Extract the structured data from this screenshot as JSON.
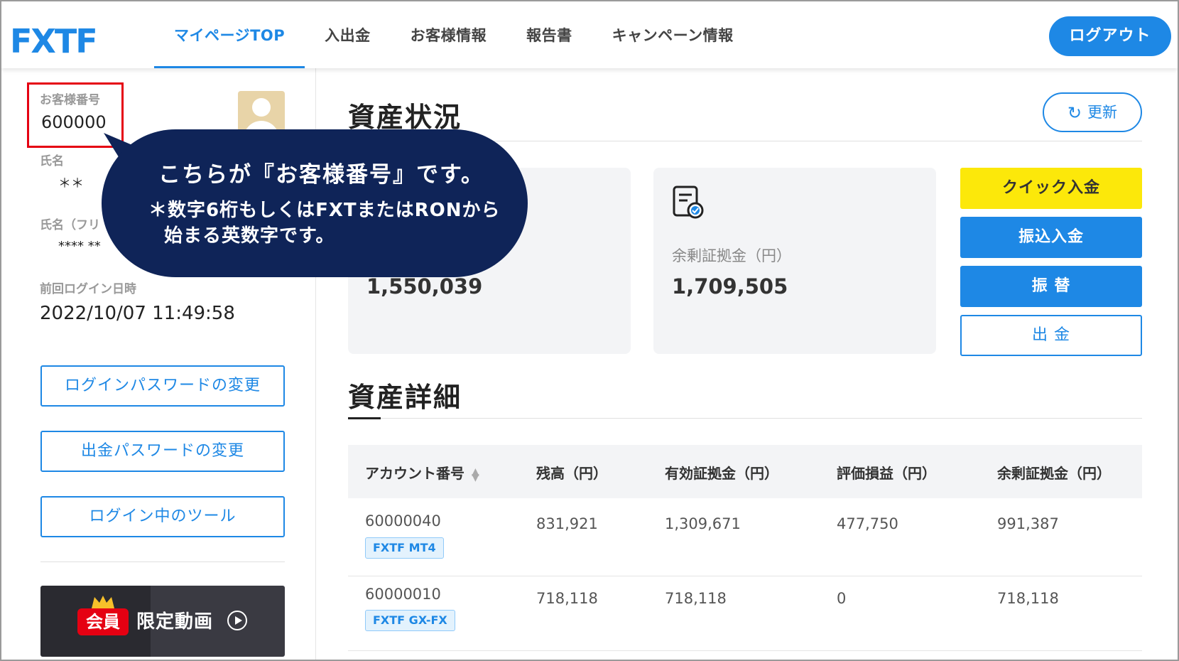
{
  "header": {
    "logo_text": "FXTF",
    "nav": [
      "マイページTOP",
      "入出金",
      "お客様情報",
      "報告書",
      "キャンペーン情報"
    ],
    "logout_label": "ログアウト"
  },
  "sidebar": {
    "customer_number_label": "お客様番号",
    "customer_number": "600000",
    "name_label": "氏名",
    "name_value": "＊＊",
    "kana_label": "氏名（フリ",
    "kana_value": "**** **",
    "last_login_label": "前回ログイン日時",
    "last_login_value": "2022/10/07 11:49:58",
    "buttons": [
      "ログインパスワードの変更",
      "出金パスワードの変更",
      "ログイン中のツール"
    ],
    "member_badge": "会員",
    "member_text": "限定動画"
  },
  "callout": {
    "title": "こちらが『お客様番号』です。",
    "note_line1": "＊数字6桁もしくはFXTまたはRONから",
    "note_line2": "始まる英数字です。"
  },
  "assets": {
    "title": "資産状況",
    "refresh_label": "更新",
    "cards": [
      {
        "label": "",
        "value": "1,550,039",
        "icon": "clipboard-icon"
      },
      {
        "label": "余剰証拠金（円）",
        "value": "1,709,505",
        "icon": "document-check-icon"
      }
    ],
    "actions": [
      "クイック入金",
      "振込入金",
      "振 替",
      "出 金"
    ]
  },
  "details": {
    "title": "資産詳細",
    "columns": [
      "アカウント番号",
      "残高（円）",
      "有効証拠金（円）",
      "評価損益（円）",
      "余剰証拠金（円）"
    ],
    "rows": [
      {
        "account": "60000040",
        "tag": "FXTF MT4",
        "balance": "831,921",
        "equity": "1,309,671",
        "pl": "477,750",
        "free_margin": "991,387"
      },
      {
        "account": "60000010",
        "tag": "FXTF GX-FX",
        "balance": "718,118",
        "equity": "718,118",
        "pl": "0",
        "free_margin": "718,118"
      }
    ]
  },
  "colors": {
    "brand_blue": "#1e88e5",
    "quick_yellow": "#fce80a",
    "callout_navy": "#0f2458",
    "highlight_red": "#e50012"
  }
}
